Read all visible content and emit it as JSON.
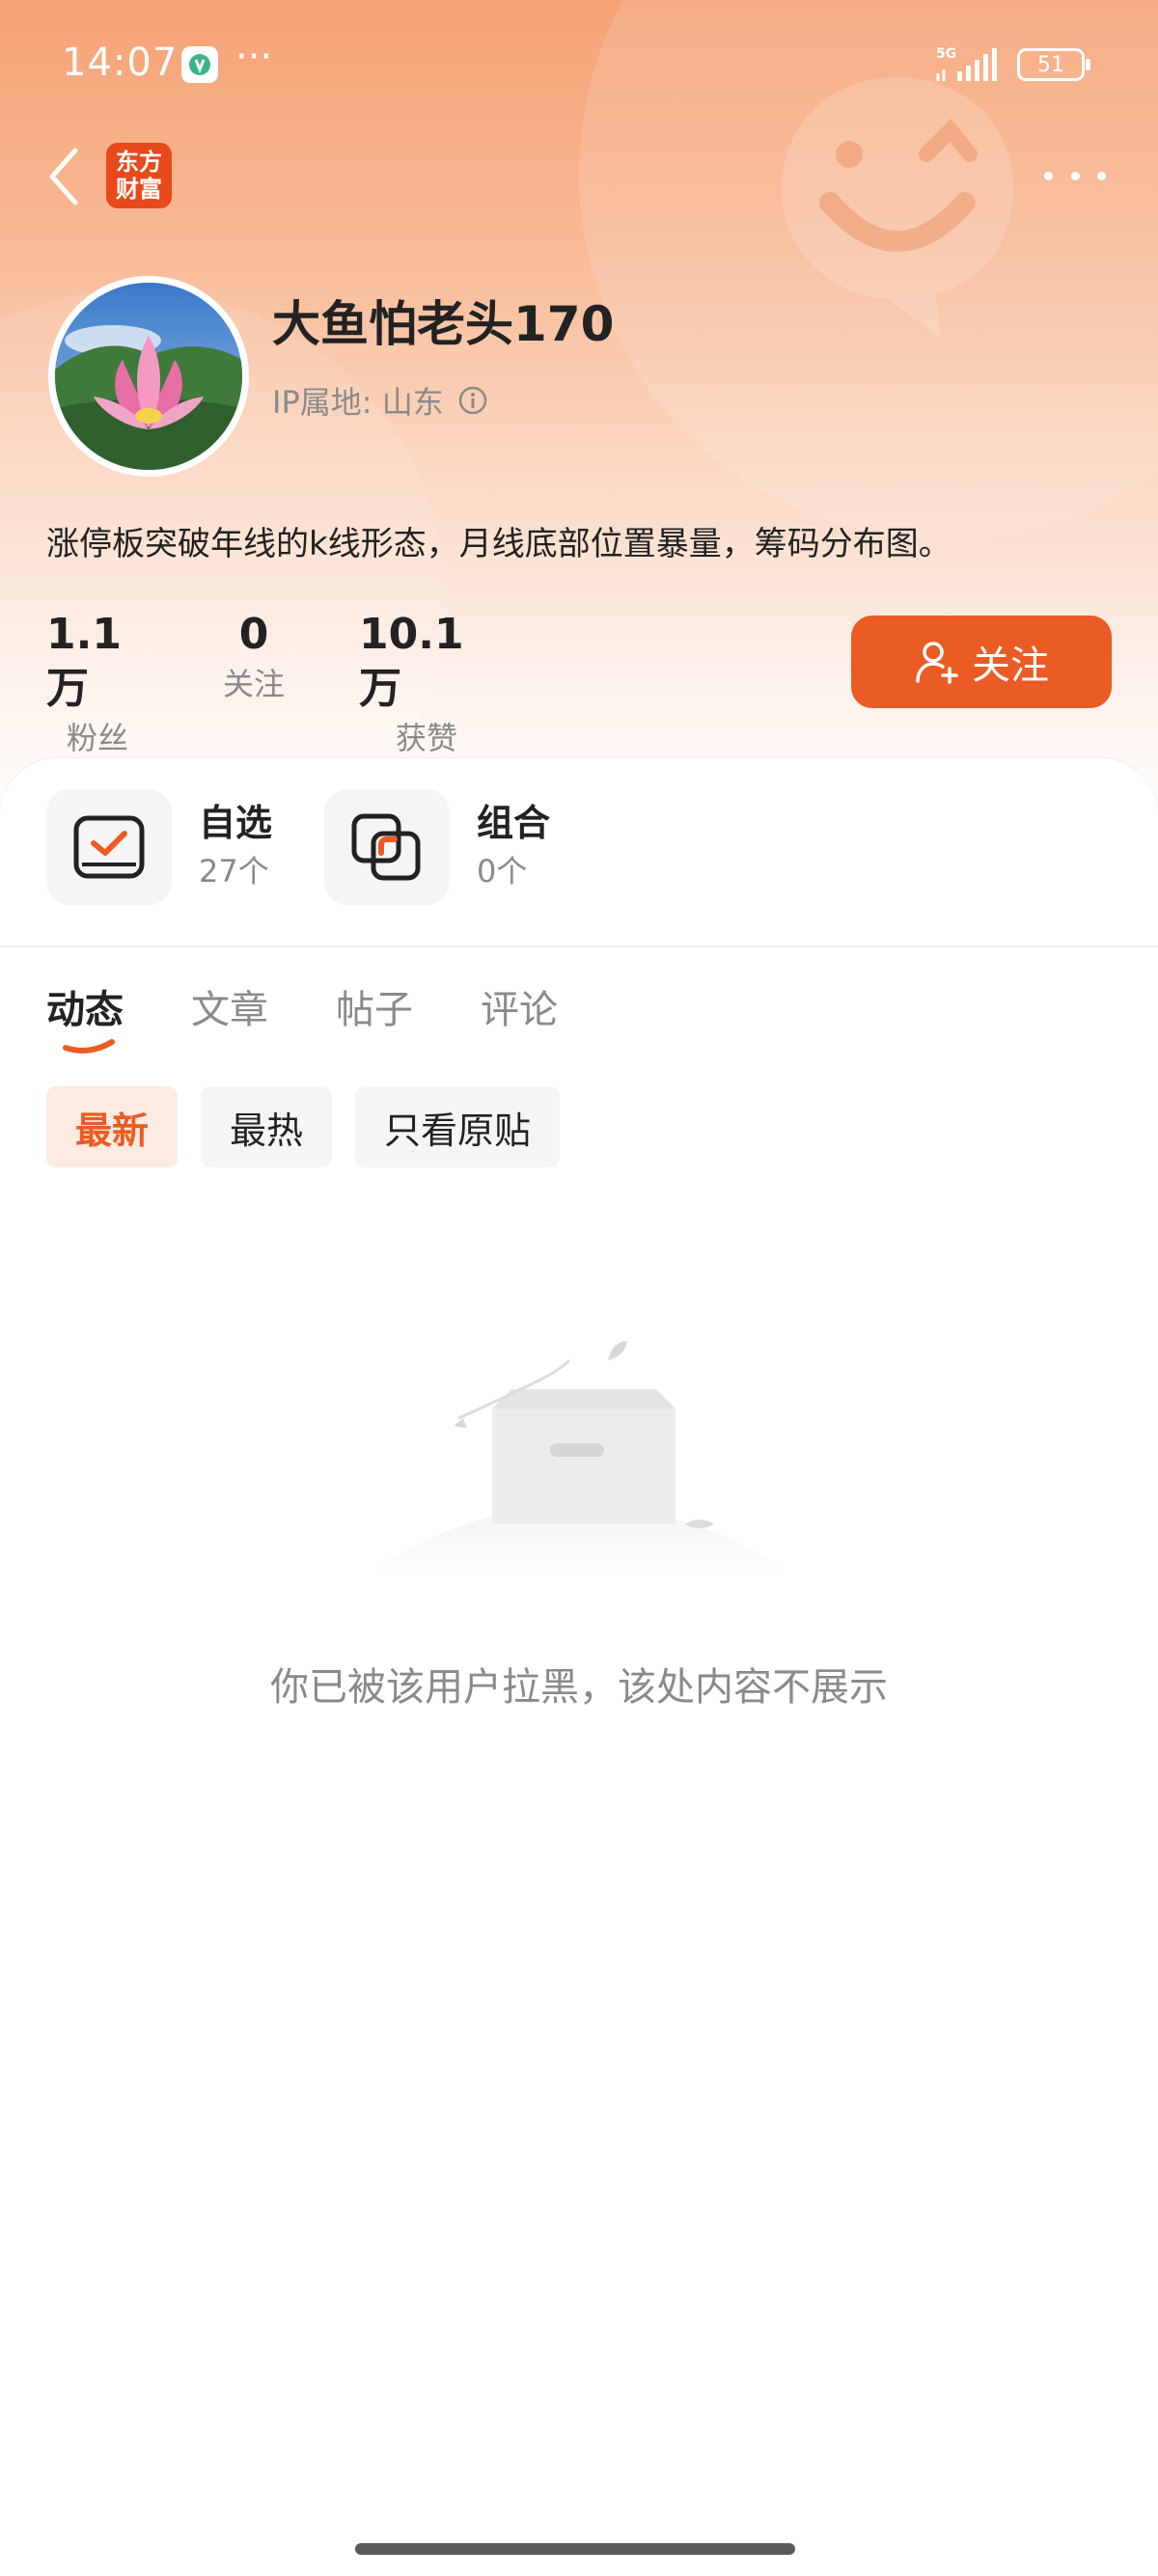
{
  "status_bar": {
    "time": "14:07",
    "more": "···",
    "network": "5G",
    "battery": "51"
  },
  "nav": {
    "logo_line1": "东方",
    "logo_line2": "财富"
  },
  "profile": {
    "username": "大鱼怕老头170",
    "ip_location": "IP属地: 山东",
    "bio": "涨停板突破年线的k线形态，月线底部位置暴量，筹码分布图。"
  },
  "stats": [
    {
      "value": "1.1万",
      "label": "粉丝"
    },
    {
      "value": "0",
      "label": "关注"
    },
    {
      "value": "10.1万",
      "label": "获赞"
    }
  ],
  "follow_button": {
    "label": "关注"
  },
  "shortcuts": {
    "watchlist": {
      "title": "自选",
      "count": "27个"
    },
    "portfolio": {
      "title": "组合",
      "count": "0个"
    }
  },
  "tabs": [
    "动态",
    "文章",
    "帖子",
    "评论"
  ],
  "active_tab": "动态",
  "filters": [
    "最新",
    "最热",
    "只看原贴"
  ],
  "active_filter": "最新",
  "empty_state": {
    "message": "你已被该用户拉黑，该处内容不展示"
  },
  "colors": {
    "accent": "#ea5c24",
    "brand_logo": "#e84a1c",
    "text_secondary": "#8a8a8a"
  }
}
